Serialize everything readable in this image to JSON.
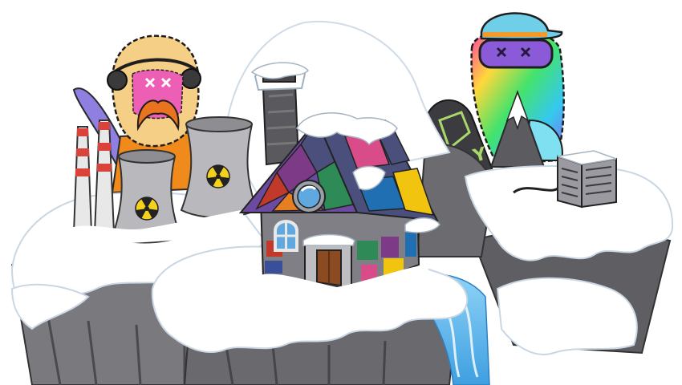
{
  "scene": {
    "background": "#ffffff",
    "snow": "#ffffff",
    "snow_shadow": "#dce6f0",
    "rock": "#6e6e72",
    "rock_dark": "#3e3e42",
    "water": "#5fb8f0"
  },
  "characters": {
    "left": {
      "icon": "yeti-goggles-character-icon",
      "fur": "#f6cf86",
      "face": "#ec5fb4",
      "mustache": "#e9731f",
      "goggles": "#3a3a3a",
      "jacket": "#f08a1a",
      "snowboard": "#8f7fe0"
    },
    "right": {
      "icon": "rainbow-yeti-cap-character-icon",
      "cap": "#6fcfe8",
      "goggles": "#8a5ad8",
      "snowboard": "#3c3c40",
      "snowboard_logo": "Y"
    }
  },
  "buildings": {
    "power_plant": {
      "icon": "nuclear-power-plant-icon",
      "tower_color": "#b9b9bd",
      "hazard_color": "#f4d21a"
    },
    "house": {
      "icon": "patchwork-cottage-icon",
      "roof_colors": [
        "#4a4f7c",
        "#7d3a86",
        "#c0392b",
        "#2e8b57",
        "#e67e22",
        "#d94c8a",
        "#1f6fb2",
        "#f1c40f"
      ]
    },
    "server": {
      "icon": "server-rack-icon",
      "color": "#9a9aa0"
    }
  }
}
